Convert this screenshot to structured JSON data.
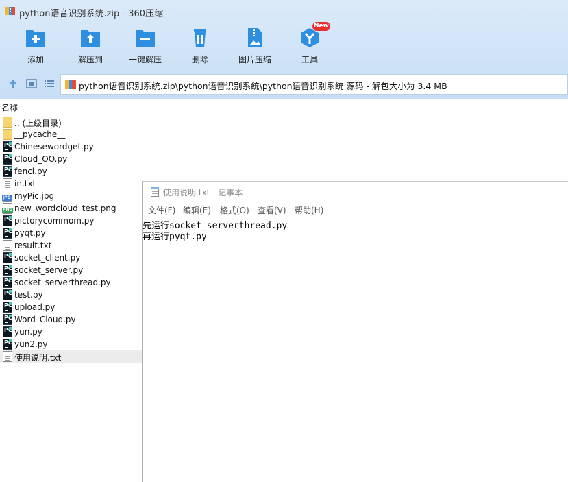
{
  "app": {
    "title": "python语音识别系统.zip - 360压缩",
    "toolbar": {
      "add": "添加",
      "extract_to": "解压到",
      "one_click_extract": "一键解压",
      "delete": "删除",
      "image_compress": "图片压缩",
      "tools": "工具",
      "tools_badge": "New"
    },
    "address_bar": {
      "path": "python语音识别系统.zip\\python语音识别系统\\python语音识别系统 源码 - 解包大小为 3.4 MB"
    },
    "columns": {
      "name": "名称"
    },
    "files": [
      {
        "name": ".. (上级目录)",
        "type": "folder"
      },
      {
        "name": "__pycache__",
        "type": "folder"
      },
      {
        "name": "Chinesewordget.py",
        "type": "py"
      },
      {
        "name": "Cloud_OO.py",
        "type": "py"
      },
      {
        "name": "fenci.py",
        "type": "py"
      },
      {
        "name": "in.txt",
        "type": "txt"
      },
      {
        "name": "myPic.jpg",
        "type": "jpg"
      },
      {
        "name": "new_wordcloud_test.png",
        "type": "png"
      },
      {
        "name": "pictorycommom.py",
        "type": "py"
      },
      {
        "name": "pyqt.py",
        "type": "py"
      },
      {
        "name": "result.txt",
        "type": "txt"
      },
      {
        "name": "socket_client.py",
        "type": "py"
      },
      {
        "name": "socket_server.py",
        "type": "py"
      },
      {
        "name": "socket_serverthread.py",
        "type": "py"
      },
      {
        "name": "test.py",
        "type": "py"
      },
      {
        "name": "upload.py",
        "type": "py"
      },
      {
        "name": "Word_Cloud.py",
        "type": "py"
      },
      {
        "name": "yun.py",
        "type": "py"
      },
      {
        "name": "yun2.py",
        "type": "py"
      },
      {
        "name": "使用说明.txt",
        "type": "txt",
        "selected": true
      }
    ]
  },
  "notepad": {
    "title": "使用说明.txt - 记事本",
    "menu": {
      "file": "文件(F)",
      "edit": "编辑(E)",
      "format": "格式(O)",
      "view": "查看(V)",
      "help": "帮助(H)"
    },
    "lines": [
      "先运行socket_serverthread.py",
      "再运行pyqt.py"
    ]
  },
  "colors": {
    "top_bg": "#cfe3f7",
    "icon_blue": "#2e8fe0",
    "selected_row": "#ececec",
    "badge_red": "#e8312f"
  }
}
